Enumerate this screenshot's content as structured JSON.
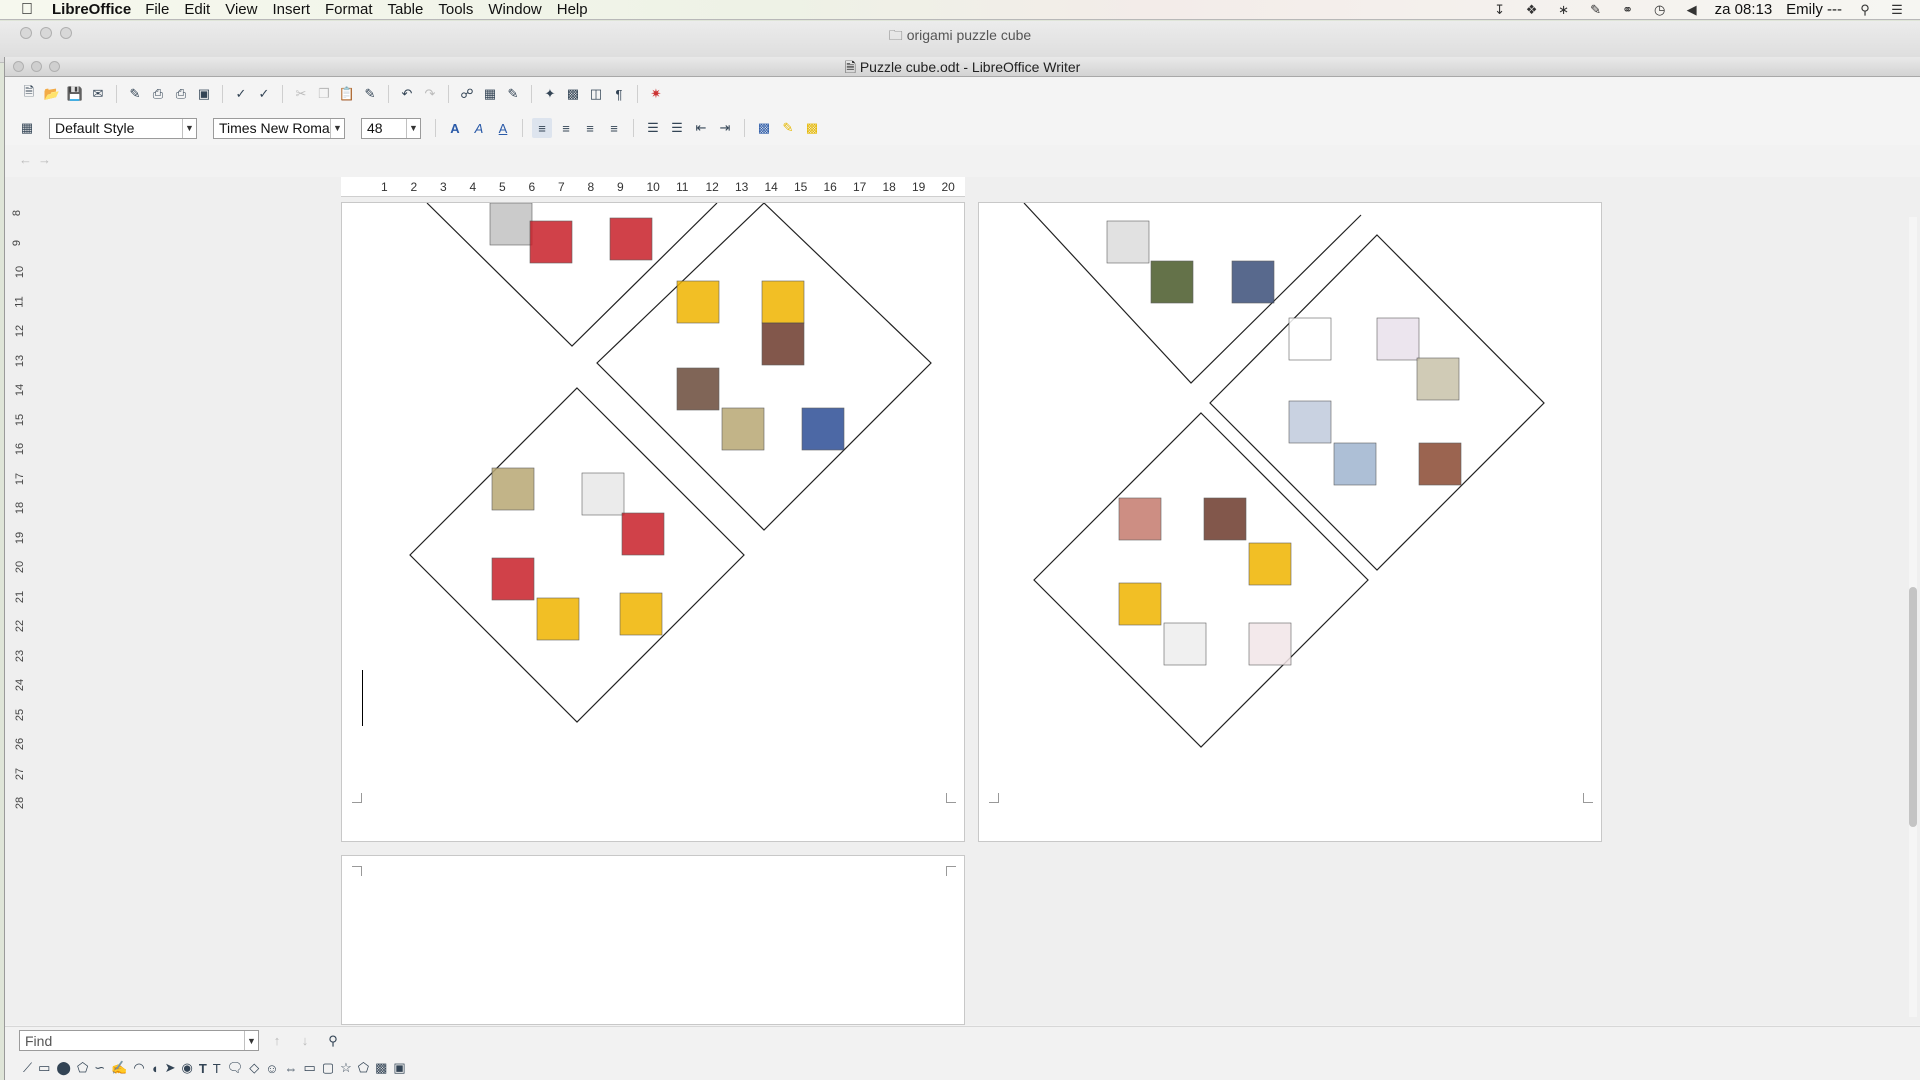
{
  "menubar": {
    "app": "LibreOffice",
    "items": [
      "File",
      "Edit",
      "View",
      "Insert",
      "Format",
      "Table",
      "Tools",
      "Window",
      "Help"
    ],
    "clock": "za 08:13",
    "user": "Emily ---"
  },
  "finder": {
    "title": "origami puzzle cube"
  },
  "window": {
    "title": "Puzzle cube.odt - LibreOffice Writer"
  },
  "format": {
    "paragraph_style": "Default Style",
    "font_name": "Times New Roma",
    "font_size": "48"
  },
  "hruler": [
    "1",
    "2",
    "3",
    "4",
    "5",
    "6",
    "7",
    "8",
    "9",
    "10",
    "11",
    "12",
    "13",
    "14",
    "15",
    "16",
    "17",
    "18",
    "19",
    "20"
  ],
  "vruler": [
    "8",
    "9",
    "10",
    "11",
    "12",
    "13",
    "14",
    "15",
    "16",
    "17",
    "18",
    "19",
    "20",
    "21",
    "22",
    "23",
    "24",
    "25",
    "26",
    "27",
    "28"
  ],
  "find": {
    "placeholder": "Find"
  },
  "colors": {
    "accent_red": "#c0392b",
    "accent_yellow": "#f0b400",
    "line": "#222222"
  },
  "puzzle_page_1": {
    "diamonds": [
      {
        "tiles": [
          "#c3c3c3",
          "#c8202a",
          "#c8202a"
        ]
      },
      {
        "tiles": [
          "#f0b400",
          "#f0b400",
          "#6d3a2c",
          "#6b4b3a",
          "#b8a774",
          "#2d4e96"
        ]
      },
      {
        "tiles": [
          "#b8a774",
          "#e8e8e8",
          "#c8202a",
          "#c8202a",
          "#f0b400",
          "#f0b400"
        ]
      }
    ]
  },
  "puzzle_page_2": {
    "diamonds": [
      {
        "tiles": [
          "#dcdcdc",
          "#4a5a2a",
          "#3b4f7a"
        ]
      },
      {
        "tiles": [
          "#ffffff",
          "#e9e1ec",
          "#c8c2aa",
          "#c0cbdc",
          "#9fb5d0",
          "#8a4a32"
        ]
      },
      {
        "tiles": [
          "#c57b6e",
          "#6d3a2c",
          "#f0b400",
          "#f0b400",
          "#eeeeee",
          "#f2e6e8"
        ]
      }
    ]
  }
}
